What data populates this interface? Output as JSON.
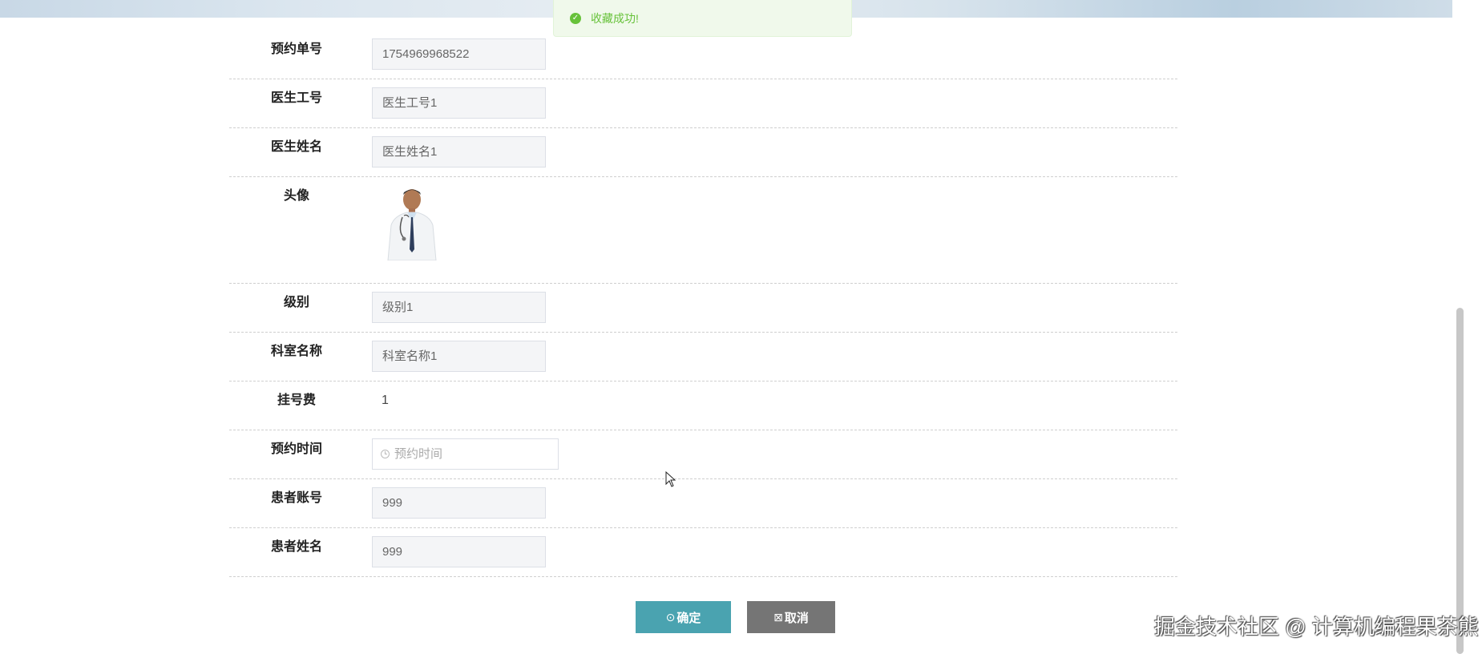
{
  "toast": {
    "message": "收藏成功!",
    "icon": "check-circle-icon",
    "color": "#67c23a"
  },
  "form": {
    "order_no": {
      "label": "预约单号",
      "value": "1754969968522"
    },
    "doctor_id": {
      "label": "医生工号",
      "value": "医生工号1"
    },
    "doctor_name": {
      "label": "医生姓名",
      "value": "医生姓名1"
    },
    "avatar": {
      "label": "头像"
    },
    "level": {
      "label": "级别",
      "value": "级别1"
    },
    "department": {
      "label": "科室名称",
      "value": "科室名称1"
    },
    "fee": {
      "label": "挂号费",
      "value": "1"
    },
    "appointment_time": {
      "label": "预约时间",
      "placeholder": "预约时间"
    },
    "patient_account": {
      "label": "患者账号",
      "value": "999"
    },
    "patient_name": {
      "label": "患者姓名",
      "value": "999"
    }
  },
  "buttons": {
    "confirm": {
      "icon": "⊙",
      "label": "确定",
      "color": "#4aa3b0"
    },
    "cancel": {
      "icon": "⊠",
      "label": "取消",
      "color": "#757575"
    }
  },
  "watermark": "掘金技术社区 @ 计算机编程果茶熊"
}
